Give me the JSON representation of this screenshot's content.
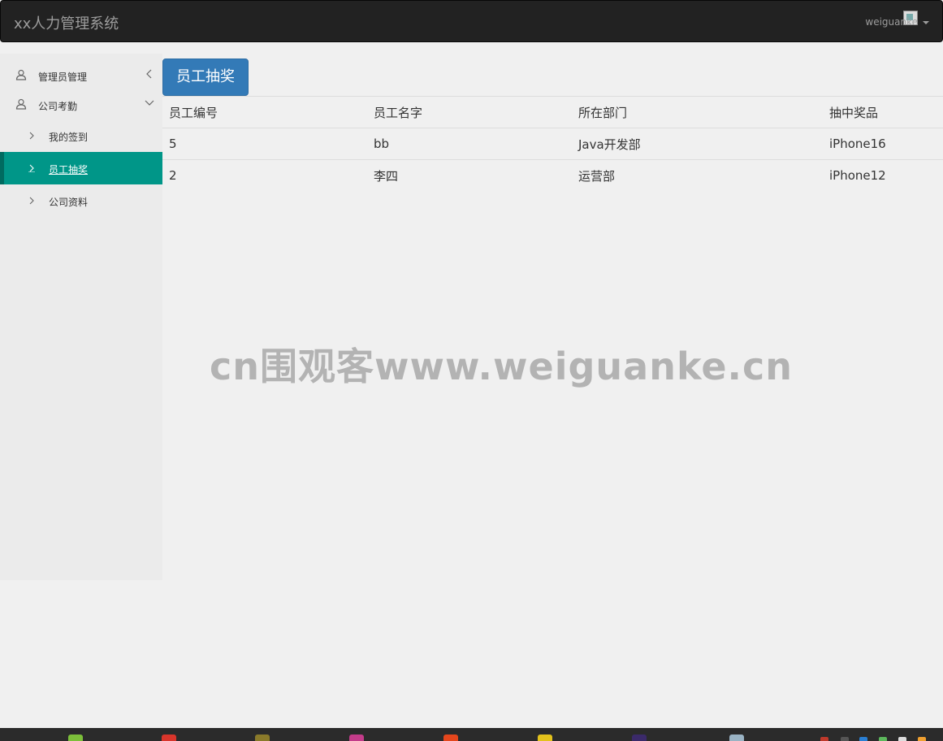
{
  "header": {
    "brand": "xx人力管理系统",
    "user_name": "weiguanke"
  },
  "sidebar": {
    "groups": [
      {
        "label": "管理员管理",
        "icon": "user-icon",
        "arrow": "chevron-left-icon"
      },
      {
        "label": "公司考勤",
        "icon": "user-icon",
        "arrow": "chevron-down-icon"
      }
    ],
    "sub_items": [
      {
        "label": "我的签到",
        "active": false
      },
      {
        "label": "员工抽奖",
        "active": true
      },
      {
        "label": "公司资料",
        "active": false
      }
    ]
  },
  "main": {
    "title_button": "员工抽奖",
    "table": {
      "columns": [
        "员工编号",
        "员工名字",
        "所在部门",
        "抽中奖品"
      ],
      "rows": [
        [
          "5",
          "bb",
          "Java开发部",
          "iPhone16"
        ],
        [
          "2",
          "李四",
          "运营部",
          "iPhone12"
        ]
      ]
    }
  },
  "watermark": "cn围观客www.weiguanke.cn",
  "colors": {
    "navbar": "#222222",
    "active_item": "#009688",
    "primary_button": "#337ab7"
  }
}
